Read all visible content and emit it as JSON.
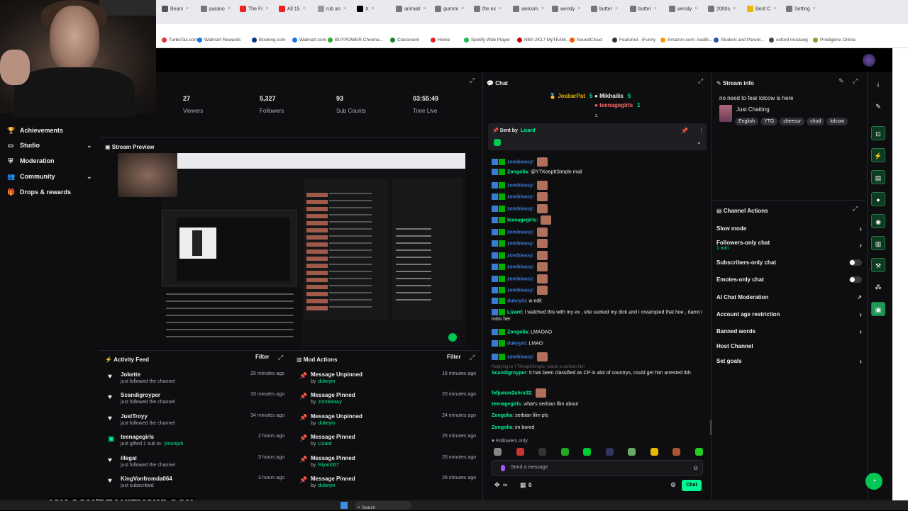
{
  "browser": {
    "tabs": [
      {
        "label": "Beani",
        "color": "#555"
      },
      {
        "label": "parano",
        "color": "#777"
      },
      {
        "label": "The Fr",
        "color": "#e22"
      },
      {
        "label": "All 15",
        "color": "#e22"
      },
      {
        "label": "rub an",
        "color": "#999"
      },
      {
        "label": "X",
        "color": "#000"
      },
      {
        "label": "animati",
        "color": "#777"
      },
      {
        "label": "gummi",
        "color": "#777"
      },
      {
        "label": "the ex",
        "color": "#777"
      },
      {
        "label": "welcom",
        "color": "#777"
      },
      {
        "label": "wendy",
        "color": "#777"
      },
      {
        "label": "butter",
        "color": "#777"
      },
      {
        "label": "butter",
        "color": "#777"
      },
      {
        "label": "wendy",
        "color": "#777"
      },
      {
        "label": "2000s",
        "color": "#777"
      },
      {
        "label": "Best C",
        "color": "#e9b800"
      },
      {
        "label": "Setting",
        "color": "#777"
      }
    ],
    "bookmarks": [
      {
        "label": "TurboTax.com",
        "color": "#d33"
      },
      {
        "label": "Walmart Rewards",
        "color": "#1a73e8"
      },
      {
        "label": "Booking.com",
        "color": "#003580"
      },
      {
        "label": "Walmart.com",
        "color": "#1a73e8"
      },
      {
        "label": "BUYPOWER Chroma...",
        "color": "#3a3"
      },
      {
        "label": "Classroom",
        "color": "#188038"
      },
      {
        "label": "Home",
        "color": "#e22"
      },
      {
        "label": "Spotify Web Player",
        "color": "#1db954"
      },
      {
        "label": "NBA 2K17 MyTEAM...",
        "color": "#c00"
      },
      {
        "label": "SoundCloud",
        "color": "#f50"
      },
      {
        "label": "Featured - iFunny",
        "color": "#333"
      },
      {
        "label": "Amazon.com: Audib...",
        "color": "#f90"
      },
      {
        "label": "Student and Parent...",
        "color": "#2255aa"
      },
      {
        "label": "oxford mustang",
        "color": "#444"
      },
      {
        "label": "Prodigene Online",
        "color": "#7a2"
      }
    ]
  },
  "sidebar": {
    "items": [
      {
        "label": "Achievements",
        "icon": "trophy-icon"
      },
      {
        "label": "Studio",
        "icon": "camera-icon",
        "expandable": true
      },
      {
        "label": "Moderation",
        "icon": "shield-icon"
      },
      {
        "label": "Community",
        "icon": "people-icon",
        "expandable": true
      },
      {
        "label": "Drops & rewards",
        "icon": "gift-icon"
      }
    ]
  },
  "stats": [
    {
      "value": "27",
      "label": "Viewers"
    },
    {
      "value": "5,327",
      "label": "Followers"
    },
    {
      "value": "93",
      "label": "Sub Counts"
    },
    {
      "value": "03:55:49",
      "label": "Time Live"
    }
  ],
  "preview": {
    "title": "Stream Preview"
  },
  "activity_feed": {
    "title": "Activity Feed",
    "filter": "Filter",
    "items": [
      {
        "name": "Jokette",
        "action": "just followed the channel",
        "highlight": "",
        "time": "25 minutes ago",
        "icon": "heart-icon"
      },
      {
        "name": "Scandigroyper",
        "action": "just followed the channel",
        "highlight": "",
        "time": "33 minutes ago",
        "icon": "heart-icon"
      },
      {
        "name": "JustTroyy",
        "action": "just followed the channel",
        "highlight": "",
        "time": "34 minutes ago",
        "icon": "heart-icon"
      },
      {
        "name": "teenagegirls",
        "action": "just gifted 1 sub to:",
        "highlight": "jimsrquh",
        "time": "2 hours ago",
        "icon": "gift-sub-icon"
      },
      {
        "name": "illegal",
        "action": "just followed the channel",
        "highlight": "",
        "time": "3 hours ago",
        "icon": "heart-icon"
      },
      {
        "name": "KingVonfromda064",
        "action": "just subscribed",
        "highlight": "",
        "time": "3 hours ago",
        "icon": "heart-icon"
      }
    ]
  },
  "mod_actions": {
    "title": "Mod Actions",
    "filter": "Filter",
    "items": [
      {
        "action": "Message Unpinned",
        "by": "by",
        "user": "dukeyin",
        "time": "16 minutes ago"
      },
      {
        "action": "Message Pinned",
        "by": "by",
        "user": "zombieasy",
        "time": "20 minutes ago"
      },
      {
        "action": "Message Unpinned",
        "by": "by",
        "user": "dukeyin",
        "time": "24 minutes ago"
      },
      {
        "action": "Message Pinned",
        "by": "by",
        "user": "Lizard",
        "time": "25 minutes ago"
      },
      {
        "action": "Message Pinned",
        "by": "by",
        "user": "Riyan007",
        "time": "26 minutes ago"
      },
      {
        "action": "Message Pinned",
        "by": "by",
        "user": "dukeyin",
        "time": "28 minutes ago"
      }
    ]
  },
  "chat": {
    "title": "Chat",
    "leaderboard": [
      {
        "name": "JosbarPat",
        "count": "5",
        "color": "#e9b800"
      },
      {
        "name": "Mikhailis",
        "count": "5",
        "color": "#efeff1"
      },
      {
        "name": "teenagegirls",
        "count": "1",
        "color": "#ff6b6b"
      }
    ],
    "pinned": {
      "label": "Sent by",
      "user": "Lizard"
    },
    "messages": [
      {
        "user": "zombieasy",
        "color": "#3a7bd5",
        "text": "",
        "emote": true
      },
      {
        "user": "Zongolia",
        "color": "#00f593",
        "text": "@YTKeepItSimple mail",
        "emote": false
      },
      {
        "user": "zombieasy",
        "color": "#3a7bd5",
        "text": "",
        "emote": true
      },
      {
        "user": "zombieasy",
        "color": "#3a7bd5",
        "text": "",
        "emote": true
      },
      {
        "user": "zombieasy",
        "color": "#3a7bd5",
        "text": "",
        "emote": true
      },
      {
        "user": "teenagegirls",
        "color": "#00f593",
        "text": "",
        "emote": true
      },
      {
        "user": "zombieasy",
        "color": "#3a7bd5",
        "text": "",
        "emote": true
      },
      {
        "user": "zombieasy",
        "color": "#3a7bd5",
        "text": "",
        "emote": true
      },
      {
        "user": "zombieasy",
        "color": "#3a7bd5",
        "text": "",
        "emote": true
      },
      {
        "user": "zombieasy",
        "color": "#3a7bd5",
        "text": "",
        "emote": true
      },
      {
        "user": "zombieasy",
        "color": "#3a7bd5",
        "text": "",
        "emote": true
      },
      {
        "user": "zombieasy",
        "color": "#3a7bd5",
        "text": "",
        "emote": true
      },
      {
        "user": "dukeyin",
        "color": "#3a7bd5",
        "text": "w edit",
        "emote": false
      },
      {
        "user": "Lizard",
        "color": "#00f593",
        "text": "I watched this with my ex , she sucked my dick and I creampied that hoe , damn i miss her",
        "emote": false
      },
      {
        "user": "Zongolia",
        "color": "#00f593",
        "text": "LMAOAO",
        "emote": false
      },
      {
        "user": "dukeyin",
        "color": "#3a7bd5",
        "text": "LMAO",
        "emote": false
      },
      {
        "user": "zombieasy",
        "color": "#3a7bd5",
        "text": "",
        "emote": true
      }
    ],
    "reply_note": "Replying to YTKeepItSimple: watch a serbian film",
    "messages2": [
      {
        "user": "Scandigroyper",
        "color": "#00f593",
        "text": "It has been classified as CP in alot of countrys, could get him arrested tbh"
      },
      {
        "user": "fefjueuw2uhru32",
        "color": "#00f593",
        "text": ""
      },
      {
        "user": "teenagegirls",
        "color": "#00f593",
        "text": "what's serbian film about"
      },
      {
        "user": "Zongolia",
        "color": "#00f593",
        "text": "serbian film pls"
      },
      {
        "user": "Zongolia",
        "color": "#00f593",
        "text": "im bored"
      }
    ],
    "followers_only": "Followers only",
    "placeholder": "Send a message",
    "send": "Chat",
    "points": "0"
  },
  "stream_info": {
    "title": "Stream info",
    "stream_title": "no need to fear lolcow is here",
    "category": "Just Chatting",
    "tags": [
      "English",
      "YTG",
      "cheesur",
      "chud",
      "lolcow"
    ]
  },
  "channel_actions": {
    "title": "Channel Actions",
    "items": [
      {
        "label": "Slow mode",
        "sub": "",
        "control": "chevron"
      },
      {
        "label": "Followers-only chat",
        "sub": "1 min",
        "control": "chevron"
      },
      {
        "label": "Subscribers-only chat",
        "sub": "",
        "control": "toggle"
      },
      {
        "label": "Emotes-only chat",
        "sub": "",
        "control": "toggle"
      },
      {
        "label": "AI Chat Moderation",
        "sub": "",
        "control": "external"
      },
      {
        "label": "Account age restriction",
        "sub": "",
        "control": "chevron"
      },
      {
        "label": "Banned words",
        "sub": "",
        "control": "chevron"
      },
      {
        "label": "Host Channel",
        "sub": "",
        "control": "none"
      },
      {
        "label": "Set goals",
        "sub": "",
        "control": "chevron"
      }
    ]
  },
  "overlay": {
    "url": "ICK.COM/BEANIEKOWLOON"
  },
  "taskbar": {
    "search": "Search"
  },
  "colors": {
    "accent": "#00f593",
    "bg": "#0e0e10",
    "panel_border": "#26262c"
  }
}
